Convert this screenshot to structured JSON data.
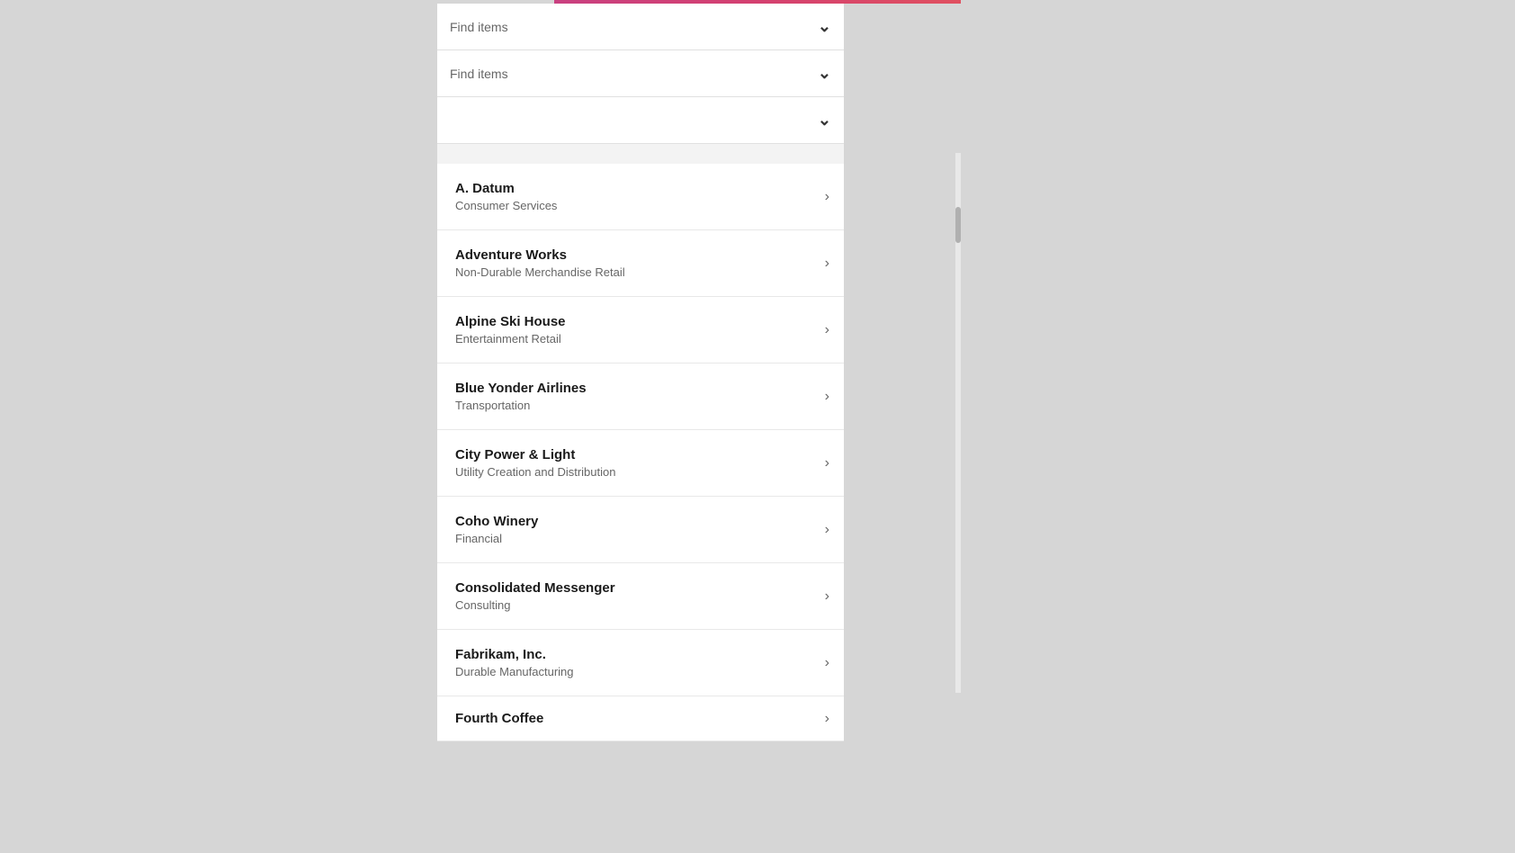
{
  "topBar": {
    "color": "#c94080"
  },
  "filters": [
    {
      "id": "filter1",
      "placeholder": "Find items",
      "hasValue": false
    },
    {
      "id": "filter2",
      "placeholder": "Find items",
      "hasValue": false
    },
    {
      "id": "filter3",
      "placeholder": "",
      "hasValue": false
    }
  ],
  "listItems": [
    {
      "id": "a-datum",
      "title": "A. Datum",
      "subtitle": "Consumer Services"
    },
    {
      "id": "adventure-works",
      "title": "Adventure Works",
      "subtitle": "Non-Durable Merchandise Retail"
    },
    {
      "id": "alpine-ski-house",
      "title": "Alpine Ski House",
      "subtitle": "Entertainment Retail"
    },
    {
      "id": "blue-yonder-airlines",
      "title": "Blue Yonder Airlines",
      "subtitle": "Transportation"
    },
    {
      "id": "city-power-light",
      "title": "City Power & Light",
      "subtitle": "Utility Creation and Distribution"
    },
    {
      "id": "coho-winery",
      "title": "Coho Winery",
      "subtitle": "Financial"
    },
    {
      "id": "consolidated-messenger",
      "title": "Consolidated Messenger",
      "subtitle": "Consulting"
    },
    {
      "id": "fabrikam-inc",
      "title": "Fabrikam, Inc.",
      "subtitle": "Durable Manufacturing"
    }
  ],
  "partialItem": {
    "title": "Fourth Coffee"
  },
  "icons": {
    "chevronDown": "⌄",
    "chevronRight": "›"
  }
}
